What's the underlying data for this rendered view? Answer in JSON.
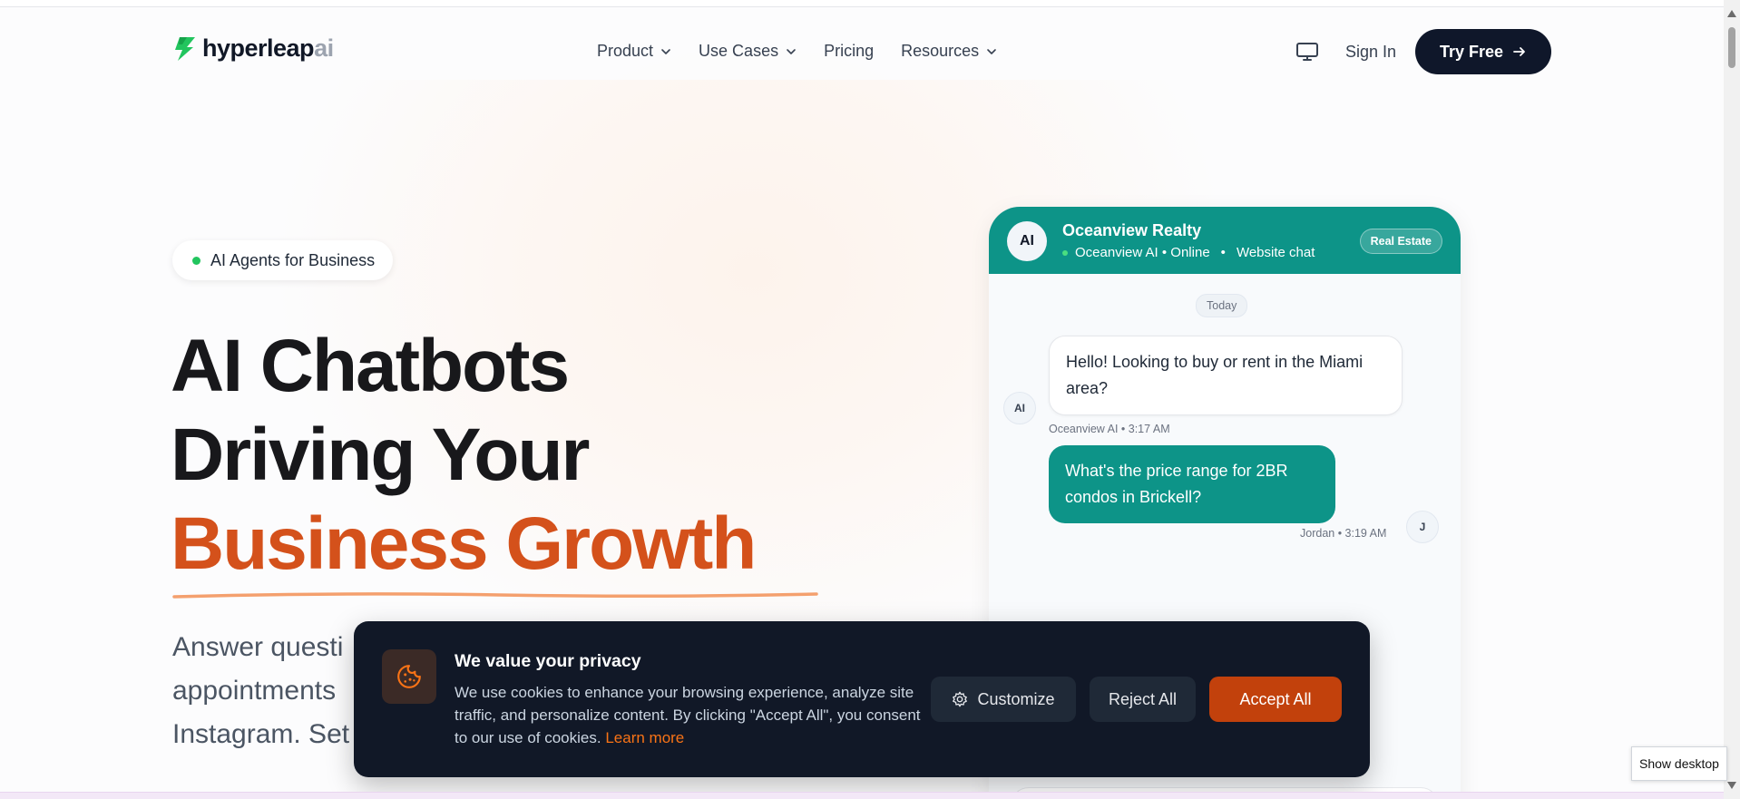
{
  "header": {
    "logo_text": "hyperleap",
    "logo_ai": "ai",
    "nav": [
      {
        "label": "Product",
        "dropdown": true
      },
      {
        "label": "Use Cases",
        "dropdown": true
      },
      {
        "label": "Pricing",
        "dropdown": false
      },
      {
        "label": "Resources",
        "dropdown": true
      }
    ],
    "sign_in": "Sign In",
    "try_free": "Try Free"
  },
  "hero": {
    "badge": "AI Agents for Business",
    "title_line1": "AI Chatbots",
    "title_line2": "Driving Your",
    "title_line3": "Business Growth",
    "subtitle_line1": "Answer questi",
    "subtitle_line2": "appointments",
    "subtitle_line3": "Instagram. Set"
  },
  "chat": {
    "avatar": "AI",
    "name": "Oceanview Realty",
    "status_agent": "Oceanview AI • Online",
    "status_channel": "Website chat",
    "tag": "Real Estate",
    "date_divider": "Today",
    "messages": [
      {
        "from": "bot",
        "text": "Hello! Looking to buy or rent in the Miami area?",
        "meta": "Oceanview AI • 3:17 AM",
        "avatar": "AI"
      },
      {
        "from": "user",
        "text": "What's the price range for 2BR condos in Brickell?",
        "meta": "Jordan • 3:19 AM",
        "avatar": "J"
      }
    ]
  },
  "cookie": {
    "title": "We value your privacy",
    "text": "We use cookies to enhance your browsing experience, analyze site traffic, and personalize content. By clicking \"Accept All\", you consent to our use of cookies.",
    "learn_more": "Learn more",
    "customize": "Customize",
    "reject": "Reject All",
    "accept": "Accept All"
  },
  "system": {
    "show_desktop": "Show desktop"
  },
  "colors": {
    "accent_orange": "#d4511b",
    "teal": "#0d9488",
    "dark": "#0f172a"
  }
}
